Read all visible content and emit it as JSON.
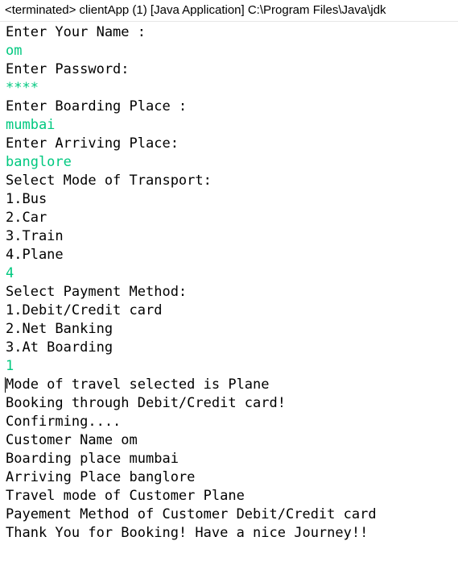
{
  "status": {
    "text": "<terminated> clientApp (1) [Java Application] C:\\Program Files\\Java\\jdk"
  },
  "colors": {
    "output_text": "#000000",
    "user_input_text": "#00c87f",
    "background": "#ffffff"
  },
  "console": {
    "lines": [
      {
        "text": "Enter Your Name :",
        "kind": "output"
      },
      {
        "text": "om",
        "kind": "input"
      },
      {
        "text": "Enter Password:",
        "kind": "output"
      },
      {
        "text": "****",
        "kind": "input"
      },
      {
        "text": "Enter Boarding Place :",
        "kind": "output"
      },
      {
        "text": "mumbai",
        "kind": "input"
      },
      {
        "text": "Enter Arriving Place:",
        "kind": "output"
      },
      {
        "text": "banglore",
        "kind": "input"
      },
      {
        "text": "Select Mode of Transport:",
        "kind": "output"
      },
      {
        "text": "1.Bus",
        "kind": "output"
      },
      {
        "text": "2.Car",
        "kind": "output"
      },
      {
        "text": "3.Train",
        "kind": "output"
      },
      {
        "text": "4.Plane",
        "kind": "output"
      },
      {
        "text": "4",
        "kind": "input"
      },
      {
        "text": "Select Payment Method:",
        "kind": "output"
      },
      {
        "text": "1.Debit/Credit card",
        "kind": "output"
      },
      {
        "text": "2.Net Banking",
        "kind": "output"
      },
      {
        "text": "3.At Boarding",
        "kind": "output"
      },
      {
        "text": "1",
        "kind": "input"
      },
      {
        "text": "Mode of travel selected is Plane",
        "kind": "output",
        "caret": true
      },
      {
        "text": "Booking through Debit/Credit card!",
        "kind": "output"
      },
      {
        "text": "Confirming....",
        "kind": "output"
      },
      {
        "text": "Customer Name om",
        "kind": "output"
      },
      {
        "text": "Boarding place mumbai",
        "kind": "output"
      },
      {
        "text": "Arriving Place banglore",
        "kind": "output"
      },
      {
        "text": "Travel mode of Customer Plane",
        "kind": "output"
      },
      {
        "text": "Payement Method of Customer Debit/Credit card",
        "kind": "output"
      },
      {
        "text": "Thank You for Booking! Have a nice Journey!!",
        "kind": "output"
      }
    ]
  }
}
